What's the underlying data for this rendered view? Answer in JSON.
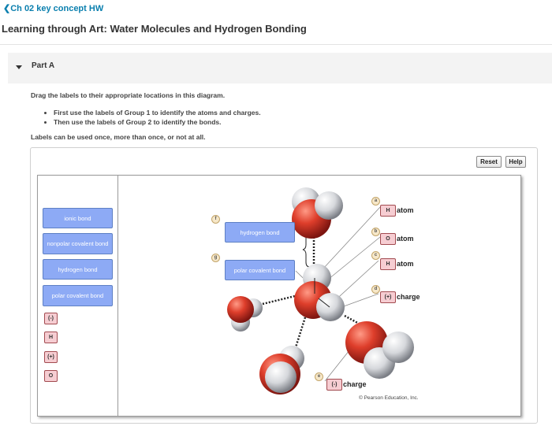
{
  "header": {
    "back_link": "Ch 02 key concept HW",
    "title": "Learning through Art: Water Molecules and Hydrogen Bonding"
  },
  "part": {
    "label": "Part A"
  },
  "instructions": {
    "intro": "Drag the labels to their appropriate locations in this diagram.",
    "bullets": [
      "First use the labels of Group 1 to identify the atoms and charges.",
      "Then use the labels of Group 2 to identify the bonds."
    ],
    "note": "Labels can be used once, more than once, or not at all."
  },
  "buttons": {
    "reset": "Reset",
    "help": "Help"
  },
  "label_bank": {
    "bond_labels": [
      "ionic bond",
      "nonpolar covalent bond",
      "hydrogen bond",
      "polar covalent bond"
    ],
    "atom_labels": [
      "(-)",
      "H",
      "(+)",
      "O"
    ]
  },
  "diagram": {
    "targets": [
      {
        "letter": "a",
        "placed": "H",
        "text": "atom"
      },
      {
        "letter": "b",
        "placed": "O",
        "text": "atom"
      },
      {
        "letter": "c",
        "placed": "H",
        "text": "atom"
      },
      {
        "letter": "d",
        "placed": "(+)",
        "text": "charge"
      },
      {
        "letter": "e",
        "placed": "(-)",
        "text": "charge"
      },
      {
        "letter": "f",
        "placed": "hydrogen bond"
      },
      {
        "letter": "g",
        "placed": "polar covalent bond"
      }
    ],
    "copyright": "© Pearson Education, Inc."
  },
  "colors": {
    "link": "#0a7fae",
    "bond_label": "#8daaf5",
    "atom_label": "#f6cdd2",
    "oxygen": "#d73a2b",
    "hydrogen": "#dcdde0"
  }
}
